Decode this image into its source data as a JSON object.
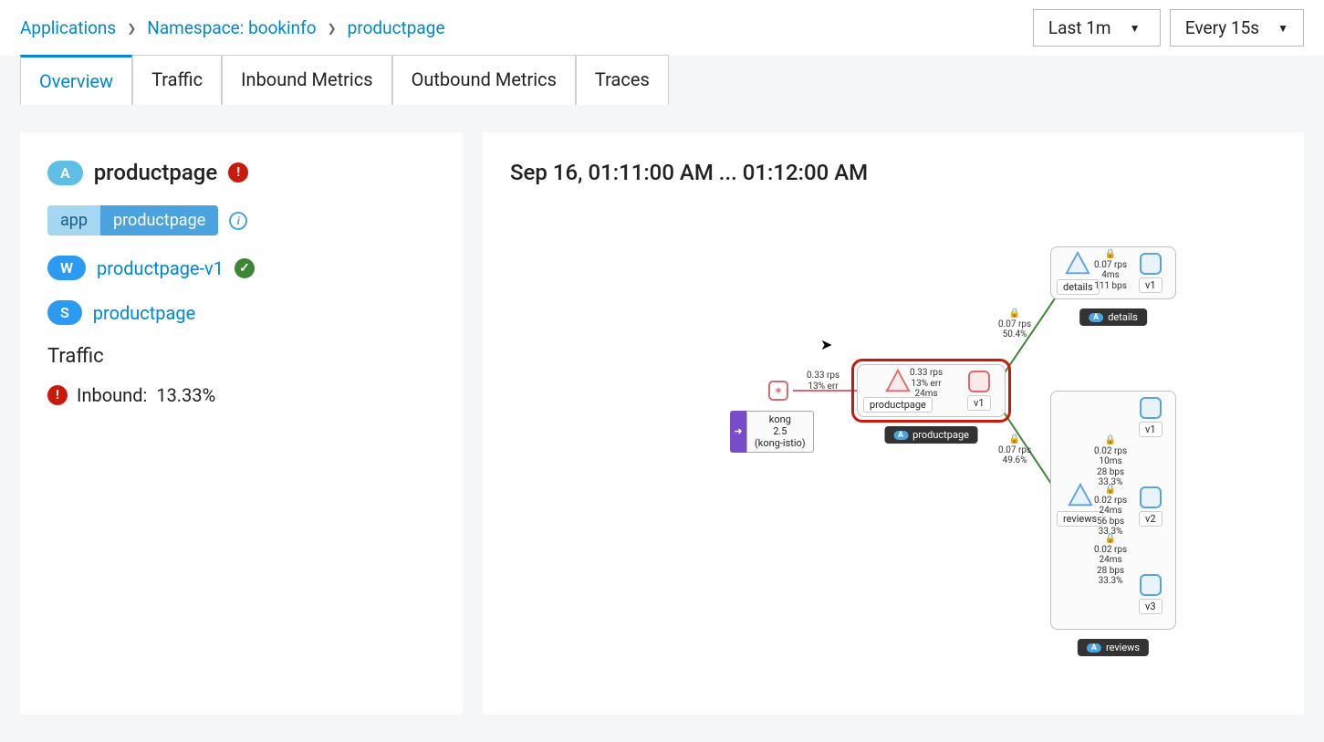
{
  "breadcrumb": {
    "l1": "Applications",
    "l2": "Namespace: bookinfo",
    "l3": "productpage"
  },
  "controls": {
    "timeRange": "Last 1m",
    "refresh": "Every 15s"
  },
  "tabs": [
    {
      "label": "Overview",
      "active": true
    },
    {
      "label": "Traffic"
    },
    {
      "label": "Inbound Metrics"
    },
    {
      "label": "Outbound Metrics"
    },
    {
      "label": "Traces"
    }
  ],
  "app": {
    "badge": "A",
    "name": "productpage",
    "status": "error",
    "labels": {
      "key": "app",
      "value": "productpage"
    }
  },
  "workloads": [
    {
      "badge": "W",
      "name": "productpage-v1",
      "status": "ok"
    }
  ],
  "services": [
    {
      "badge": "S",
      "name": "productpage"
    }
  ],
  "traffic": {
    "title": "Traffic",
    "inboundLabel": "Inbound:",
    "inboundValue": "13.33%"
  },
  "graph": {
    "timerange": "Sep 16, 01:11:00 AM ... 01:12:00 AM",
    "ingress": {
      "name": "kong",
      "version": "2.5",
      "ns": "(kong-istio)"
    },
    "edges": {
      "kong_pp": {
        "rps": "0.33 rps",
        "err": "13% err"
      },
      "pp_v1": {
        "rps": "0.33 rps",
        "err": "13% err",
        "lat": "24ms"
      },
      "pp_details": {
        "rps": "0.07 rps",
        "pct": "50.4%"
      },
      "details_v1": {
        "rps": "0.07 rps",
        "lat": "4ms",
        "bps": "111 bps"
      },
      "pp_reviews": {
        "rps": "0.07 rps",
        "pct": "49.6%"
      },
      "reviews_v1": {
        "rps": "0.02 rps",
        "lat": "10ms",
        "bps": "28 bps",
        "err": "33.3%"
      },
      "reviews_v2": {
        "rps": "0.02 rps",
        "lat": "24ms",
        "bps": "56 bps",
        "err": "33.3%"
      },
      "reviews_v3": {
        "rps": "0.02 rps",
        "lat": "24ms",
        "bps": "28 bps",
        "err": "33.3%"
      }
    },
    "groups": {
      "productpage": {
        "svc": "productpage",
        "v": "v1",
        "label": "productpage"
      },
      "details": {
        "svc": "details",
        "v": "v1",
        "label": "details"
      },
      "reviews": {
        "svc": "reviews",
        "v1": "v1",
        "v2": "v2",
        "v3": "v3",
        "label": "reviews"
      }
    }
  }
}
